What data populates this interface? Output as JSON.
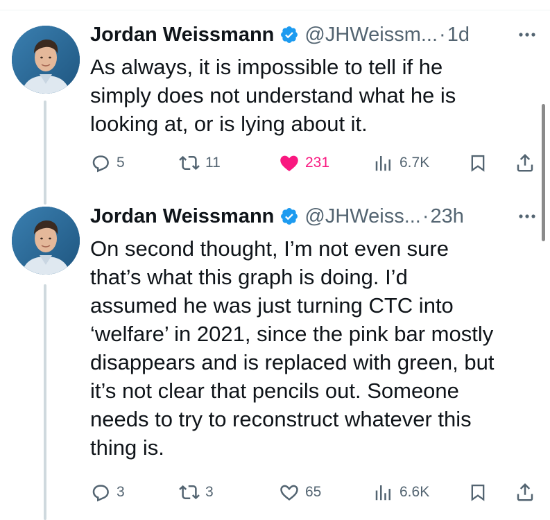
{
  "tweets": [
    {
      "author": {
        "name": "Jordan Weissmann",
        "handle": "@JHWeissm...",
        "separator": "·",
        "time": "1d"
      },
      "text_lines": [
        "As always, it is impossible to tell if he",
        "simply does not understand what he is",
        "looking at, or is lying about it."
      ],
      "actions": {
        "replies": "5",
        "reposts": "11",
        "likes": "231",
        "liked": true,
        "views": "6.7K"
      }
    },
    {
      "author": {
        "name": "Jordan Weissmann",
        "handle": "@JHWeiss...",
        "separator": "·",
        "time": "23h"
      },
      "text_lines": [
        "On second thought, I’m not even sure",
        "that’s what this graph is doing. I’d",
        "assumed he was just turning CTC into",
        "‘welfare’ in 2021, since the pink bar mostly",
        "disappears and is replaced with green, but",
        "it’s not clear that pencils out. Someone",
        "needs to try to reconstruct whatever this",
        "thing is."
      ],
      "actions": {
        "replies": "3",
        "reposts": "3",
        "likes": "65",
        "liked": false,
        "views": "6.6K"
      }
    }
  ],
  "colors": {
    "text": "#0f1419",
    "secondary": "#536471",
    "verified": "#1d9bf0",
    "like": "#f91880",
    "thread_line": "#cfd9de"
  },
  "icons": [
    "verified-badge-icon",
    "more-icon",
    "reply-icon",
    "repost-icon",
    "like-icon",
    "views-icon",
    "bookmark-icon",
    "share-icon"
  ]
}
